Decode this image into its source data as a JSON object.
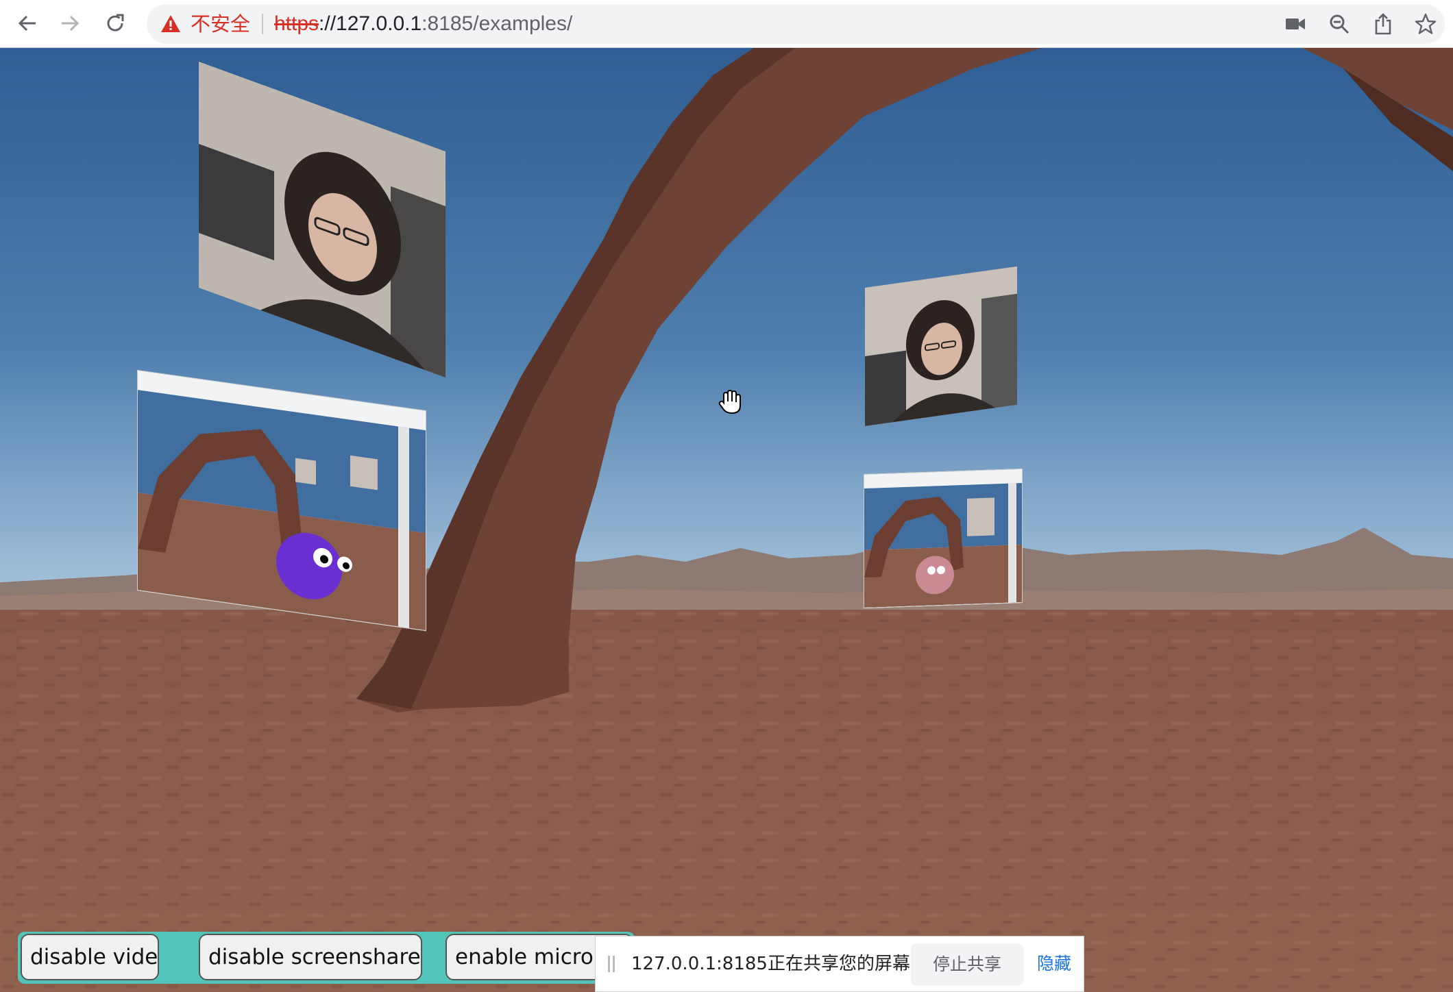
{
  "browser": {
    "security_label": "不安全",
    "url_scheme": "https",
    "url_rest": "://127.0.0.1:8185/examples/",
    "url_host": "://127.0.0.1",
    "url_tail": ":8185/examples/",
    "icons": {
      "back": "arrow-left-icon",
      "forward": "arrow-right-icon",
      "reload": "reload-icon",
      "camera": "video-camera-icon",
      "zoom": "zoom-out-icon",
      "share": "share-icon",
      "bookmark": "star-icon"
    }
  },
  "scene": {
    "cursor": "grab-hand-icon",
    "colors": {
      "sky_top": "#2d5d91",
      "sky_bottom": "#8fb2cf",
      "ground": "#8b5d4e",
      "arch": "#6b3d30",
      "avatar_purple": "#6a2fd0",
      "avatar_pink": "#c98a93"
    }
  },
  "controls": {
    "disable_video": "disable video",
    "disable_screenshare": "disable screenshare",
    "enable_microphone": "enable microph",
    "bg_color": "#52c4b8"
  },
  "sharebar": {
    "message": "127.0.0.1:8185正在共享您的屏幕。",
    "stop_label": "停止共享",
    "hide_label": "隐藏"
  }
}
